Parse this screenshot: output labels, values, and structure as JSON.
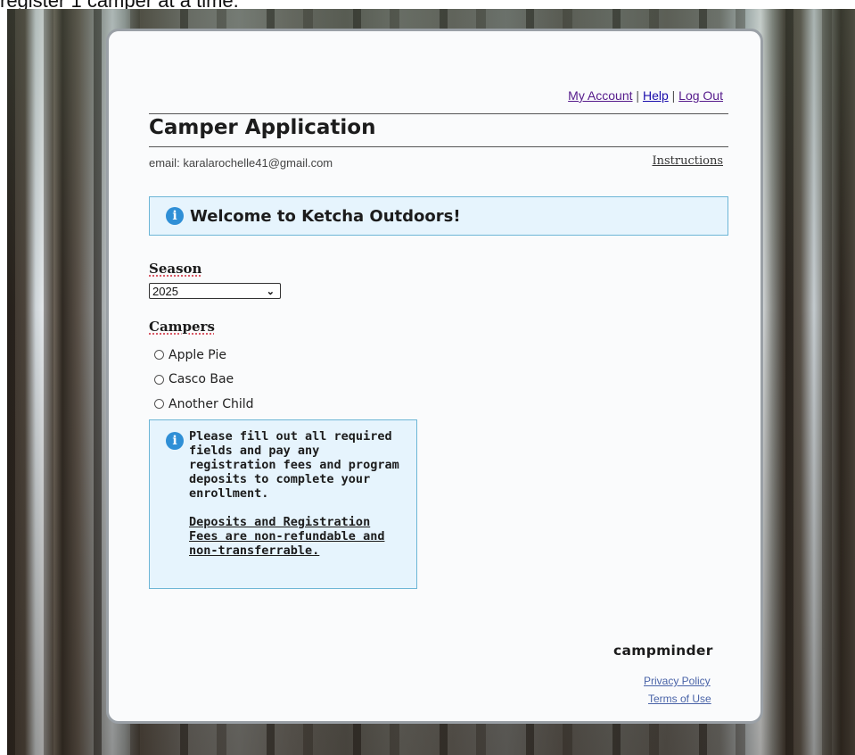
{
  "caption_text": "register 1 camper at a time.",
  "header": {
    "links": [
      {
        "label": "My Account"
      },
      {
        "label": "Help"
      },
      {
        "label": "Log Out"
      }
    ],
    "separator": "|",
    "title": "Camper Application",
    "email_label": "email:",
    "email_value": "karalarochelle41@gmail.com",
    "instructions_label": "Instructions"
  },
  "welcome": {
    "icon": "info-icon",
    "text": "Welcome to Ketcha Outdoors!"
  },
  "season": {
    "label": "Season",
    "selected": "2025"
  },
  "campers": {
    "label": "Campers",
    "items": [
      {
        "name": "Apple Pie",
        "selected": false
      },
      {
        "name": "Casco Bae",
        "selected": false
      },
      {
        "name": "Another Child",
        "selected": false
      }
    ]
  },
  "notice": {
    "icon": "info-icon",
    "text": "Please fill out all required fields and pay any registration fees and program deposits to complete your enrollment.",
    "warning": "Deposits and Registration Fees are non-refundable and non-transferrable."
  },
  "footer": {
    "brand": "campminder",
    "privacy_label": "Privacy Policy",
    "terms_label": "Terms of Use"
  },
  "colors": {
    "info_box_bg": "#e6f4fd",
    "info_box_border": "#6db6d6",
    "info_icon": "#2f8fd6",
    "link_visited": "#551a8b",
    "link": "#1a0dab"
  }
}
